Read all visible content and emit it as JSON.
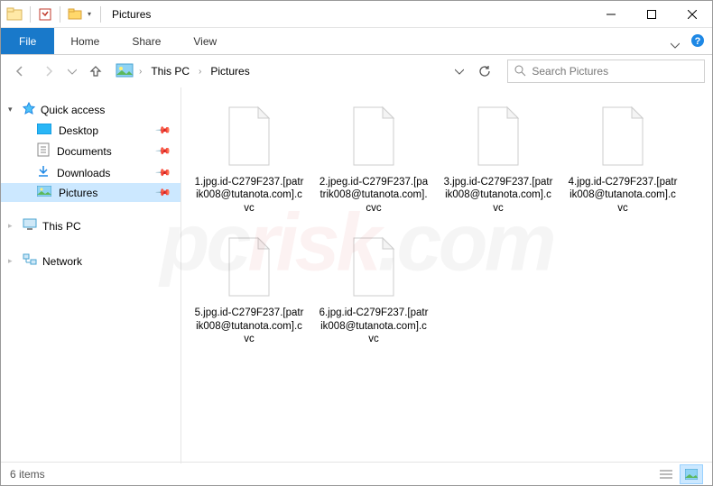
{
  "title": "Pictures",
  "ribbon": {
    "file": "File",
    "tabs": [
      "Home",
      "Share",
      "View"
    ]
  },
  "addressbar": {
    "breadcrumb": [
      "This PC",
      "Pictures"
    ]
  },
  "search": {
    "placeholder": "Search Pictures"
  },
  "nav": {
    "quick_access": "Quick access",
    "items": [
      {
        "label": "Desktop",
        "icon": "desktop",
        "pinned": true
      },
      {
        "label": "Documents",
        "icon": "documents",
        "pinned": true
      },
      {
        "label": "Downloads",
        "icon": "downloads",
        "pinned": true
      },
      {
        "label": "Pictures",
        "icon": "pictures",
        "pinned": true,
        "selected": true
      }
    ],
    "this_pc": "This PC",
    "network": "Network"
  },
  "files": [
    {
      "name": "1.jpg.id-C279F237.[patrik008@tutanota.com].cvc"
    },
    {
      "name": "2.jpeg.id-C279F237.[patrik008@tutanota.com].cvc"
    },
    {
      "name": "3.jpg.id-C279F237.[patrik008@tutanota.com].cvc"
    },
    {
      "name": "4.jpg.id-C279F237.[patrik008@tutanota.com].cvc"
    },
    {
      "name": "5.jpg.id-C279F237.[patrik008@tutanota.com].cvc"
    },
    {
      "name": "6.jpg.id-C279F237.[patrik008@tutanota.com].cvc"
    }
  ],
  "status": {
    "count_label": "6 items"
  },
  "watermark": {
    "a": "pc",
    "b": "risk",
    "c": ".com"
  }
}
